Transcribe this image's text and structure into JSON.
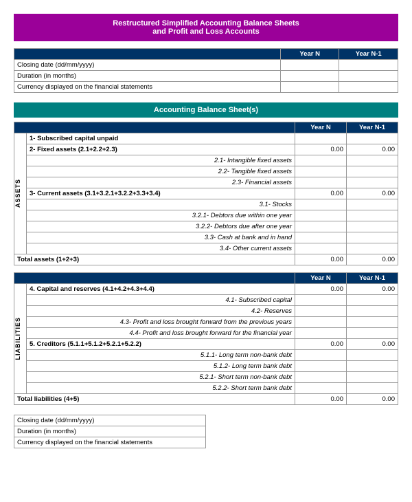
{
  "page": {
    "main_title_line1": "Restructured Simplified Accounting Balance Sheets",
    "main_title_line2": "and Profit and Loss Accounts",
    "top_info": {
      "rows": [
        {
          "label": "Closing date (dd/mm/yyyy)"
        },
        {
          "label": "Duration (in months)"
        },
        {
          "label": "Currency displayed on the financial statements"
        }
      ]
    },
    "balance_sheet_title": "Accounting Balance Sheet(s)",
    "col_year_n": "Year N",
    "col_year_n1": "Year N-1",
    "assets_label": "ASSETS",
    "liabilities_label": "LIABILITIES",
    "assets_rows": [
      {
        "type": "bold",
        "label": "1- Subscribed capital unpaid",
        "year_n": "",
        "year_n1": ""
      },
      {
        "type": "bold",
        "label": "2- Fixed assets (2.1+2.2+2.3)",
        "year_n": "0.00",
        "year_n1": "0.00"
      },
      {
        "type": "italic-right",
        "label": "2.1- Intangible fixed assets",
        "year_n": "",
        "year_n1": ""
      },
      {
        "type": "italic-right",
        "label": "2.2- Tangible fixed assets",
        "year_n": "",
        "year_n1": ""
      },
      {
        "type": "italic-right",
        "label": "2.3- Financial assets",
        "year_n": "",
        "year_n1": ""
      },
      {
        "type": "bold",
        "label": "3- Current assets (3.1+3.2.1+3.2.2+3.3+3.4)",
        "year_n": "0.00",
        "year_n1": "0.00"
      },
      {
        "type": "italic-right",
        "label": "3.1- Stocks",
        "year_n": "",
        "year_n1": ""
      },
      {
        "type": "italic-right",
        "label": "3.2.1- Debtors due within one year",
        "year_n": "",
        "year_n1": ""
      },
      {
        "type": "italic-right",
        "label": "3.2.2- Debtors due after one year",
        "year_n": "",
        "year_n1": ""
      },
      {
        "type": "italic-right",
        "label": "3.3- Cash at bank and in hand",
        "year_n": "",
        "year_n1": ""
      },
      {
        "type": "italic-right",
        "label": "3.4- Other current assets",
        "year_n": "",
        "year_n1": ""
      },
      {
        "type": "bold-total",
        "label": "Total assets (1+2+3)",
        "year_n": "0.00",
        "year_n1": "0.00"
      }
    ],
    "liabilities_rows": [
      {
        "type": "bold",
        "label": "4. Capital and reserves (4.1+4.2+4.3+4.4)",
        "year_n": "0.00",
        "year_n1": "0.00"
      },
      {
        "type": "italic-right",
        "label": "4.1- Subscribed capital",
        "year_n": "",
        "year_n1": ""
      },
      {
        "type": "italic-right",
        "label": "4.2- Reserves",
        "year_n": "",
        "year_n1": ""
      },
      {
        "type": "italic-right",
        "label": "4.3- Profit and loss brought forward from the previous years",
        "year_n": "",
        "year_n1": ""
      },
      {
        "type": "italic-right",
        "label": "4.4- Profit and loss brought forward for the financial year",
        "year_n": "",
        "year_n1": ""
      },
      {
        "type": "bold",
        "label": "5. Creditors (5.1.1+5.1.2+5.2.1+5.2.2)",
        "year_n": "0.00",
        "year_n1": "0.00"
      },
      {
        "type": "italic-right",
        "label": "5.1.1- Long term non-bank debt",
        "year_n": "",
        "year_n1": ""
      },
      {
        "type": "italic-right",
        "label": "5.1.2- Long term bank debt",
        "year_n": "",
        "year_n1": ""
      },
      {
        "type": "italic-right",
        "label": "5.2.1- Short term non-bank debt",
        "year_n": "",
        "year_n1": ""
      },
      {
        "type": "italic-right",
        "label": "5.2.2- Short term bank debt",
        "year_n": "",
        "year_n1": ""
      },
      {
        "type": "bold-total",
        "label": "Total liabilities (4+5)",
        "year_n": "0.00",
        "year_n1": "0.00"
      }
    ],
    "bottom_info": {
      "rows": [
        {
          "label": "Closing date (dd/mm/yyyy)"
        },
        {
          "label": "Duration (in months)"
        },
        {
          "label": "Currency displayed on the financial statements"
        }
      ]
    }
  }
}
